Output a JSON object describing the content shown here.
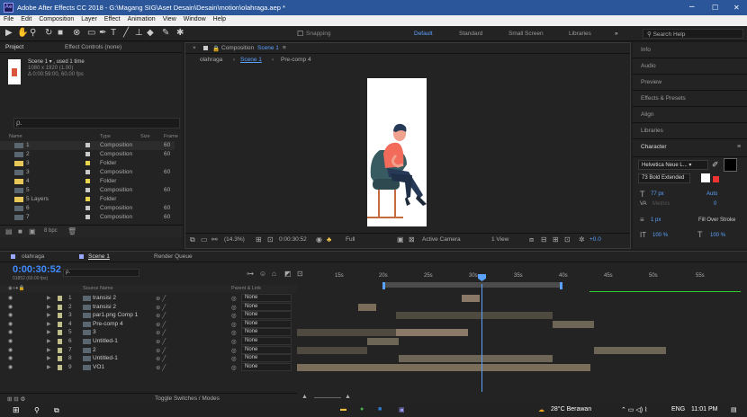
{
  "window": {
    "app_title": "Adobe After Effects CC 2018 - G:\\Magang SIG\\Aset Desain\\Desain\\motion\\olahraga.aep *",
    "app_icon": "Ae",
    "min": "–",
    "max": "☐",
    "close": "✕"
  },
  "menu": [
    "File",
    "Edit",
    "Composition",
    "Layer",
    "Effect",
    "Animation",
    "View",
    "Window",
    "Help"
  ],
  "toolbar": {
    "snapping": "Snapping",
    "workspaces": [
      "Default",
      "Standard",
      "Small Screen",
      "Libraries"
    ],
    "more": "»",
    "search_placeholder": "Search Help"
  },
  "project": {
    "tab_project": "Project",
    "tab_effects": "Effect Controls (none)",
    "item_title": "Scene 1 ▾ , used 1 time",
    "item_size": "1080 x 1920 (1.00)",
    "item_duration": "Δ 0:00:59:00, 60.00 fps",
    "search_icon_text": "ρ.",
    "col_name": "Name",
    "col_type": "Type",
    "col_size": "Size",
    "col_frame": "Frame",
    "rows": [
      {
        "name": "1",
        "type": "Composition",
        "frame": "60",
        "kind": "comp"
      },
      {
        "name": "2",
        "type": "Composition",
        "frame": "60",
        "kind": "comp"
      },
      {
        "name": "3",
        "type": "Folder",
        "frame": "",
        "kind": "folder"
      },
      {
        "name": "3",
        "type": "Composition",
        "frame": "60",
        "kind": "comp"
      },
      {
        "name": "4",
        "type": "Folder",
        "frame": "",
        "kind": "folder"
      },
      {
        "name": "5",
        "type": "Composition",
        "frame": "60",
        "kind": "comp"
      },
      {
        "name": "5 Layers",
        "type": "Folder",
        "frame": "",
        "kind": "folder"
      },
      {
        "name": "6",
        "type": "Composition",
        "frame": "60",
        "kind": "comp"
      },
      {
        "name": "7",
        "type": "Composition",
        "frame": "60",
        "kind": "comp"
      }
    ],
    "bpc": "8 bpc"
  },
  "comp": {
    "tab": "Composition",
    "tab_name": "Scene 1",
    "breadcrumbs": [
      "olahraga",
      "Scene 1",
      "Pre-comp 4"
    ],
    "zoom": "(14.3%)",
    "timecode": "0:00:30:52",
    "resolution": "Full",
    "camera": "Active Camera",
    "views": "1 View",
    "exposure": "+0.0"
  },
  "right": {
    "panels": [
      "Info",
      "Audio",
      "Preview",
      "Effects & Presets",
      "Align",
      "Libraries"
    ],
    "character": "Character",
    "font": "Helvetica Neue L...",
    "style": "73 Bold Extended",
    "font_size": "77 px",
    "leading": "Auto",
    "tracking_label": "Metrics",
    "tracking_val": "0",
    "stroke_w": "1 px",
    "stroke_mode": "Fill Over Stroke",
    "vscale": "100 %",
    "hscale": "100 %"
  },
  "timeline": {
    "tabs": [
      "olahraga",
      "Scene 1",
      "Render Queue"
    ],
    "timecode": "0:00:30:52",
    "frame_info": "01852 (60.00 fps)",
    "col_source": "Source Name",
    "col_parent": "Parent & Link",
    "toggle": "Toggle Switches / Modes",
    "ticks": [
      "15s",
      "20s",
      "25s",
      "30s",
      "35s",
      "40s",
      "45s",
      "50s",
      "55s"
    ],
    "layers": [
      {
        "num": "1",
        "name": "transisi 2",
        "parent": "None"
      },
      {
        "num": "2",
        "name": "transisi 2",
        "parent": "None"
      },
      {
        "num": "3",
        "name": "par1.png Comp 1",
        "parent": "None"
      },
      {
        "num": "4",
        "name": "Pre-comp 4",
        "parent": "None"
      },
      {
        "num": "5",
        "name": "3",
        "parent": "None"
      },
      {
        "num": "6",
        "name": "Untitled-1",
        "parent": "None"
      },
      {
        "num": "7",
        "name": "2",
        "parent": "None"
      },
      {
        "num": "8",
        "name": "Untitled-1",
        "parent": "None"
      },
      {
        "num": "9",
        "name": "VO1",
        "parent": "None"
      }
    ]
  },
  "taskbar": {
    "weather": "28°C Berawan",
    "lang": "ENG",
    "time": "11:01 PM"
  },
  "colors": {
    "accent": "#2b579a",
    "playhead": "#5ba1ff",
    "bar": "#6d6657",
    "timecode": "#3f8bff"
  }
}
